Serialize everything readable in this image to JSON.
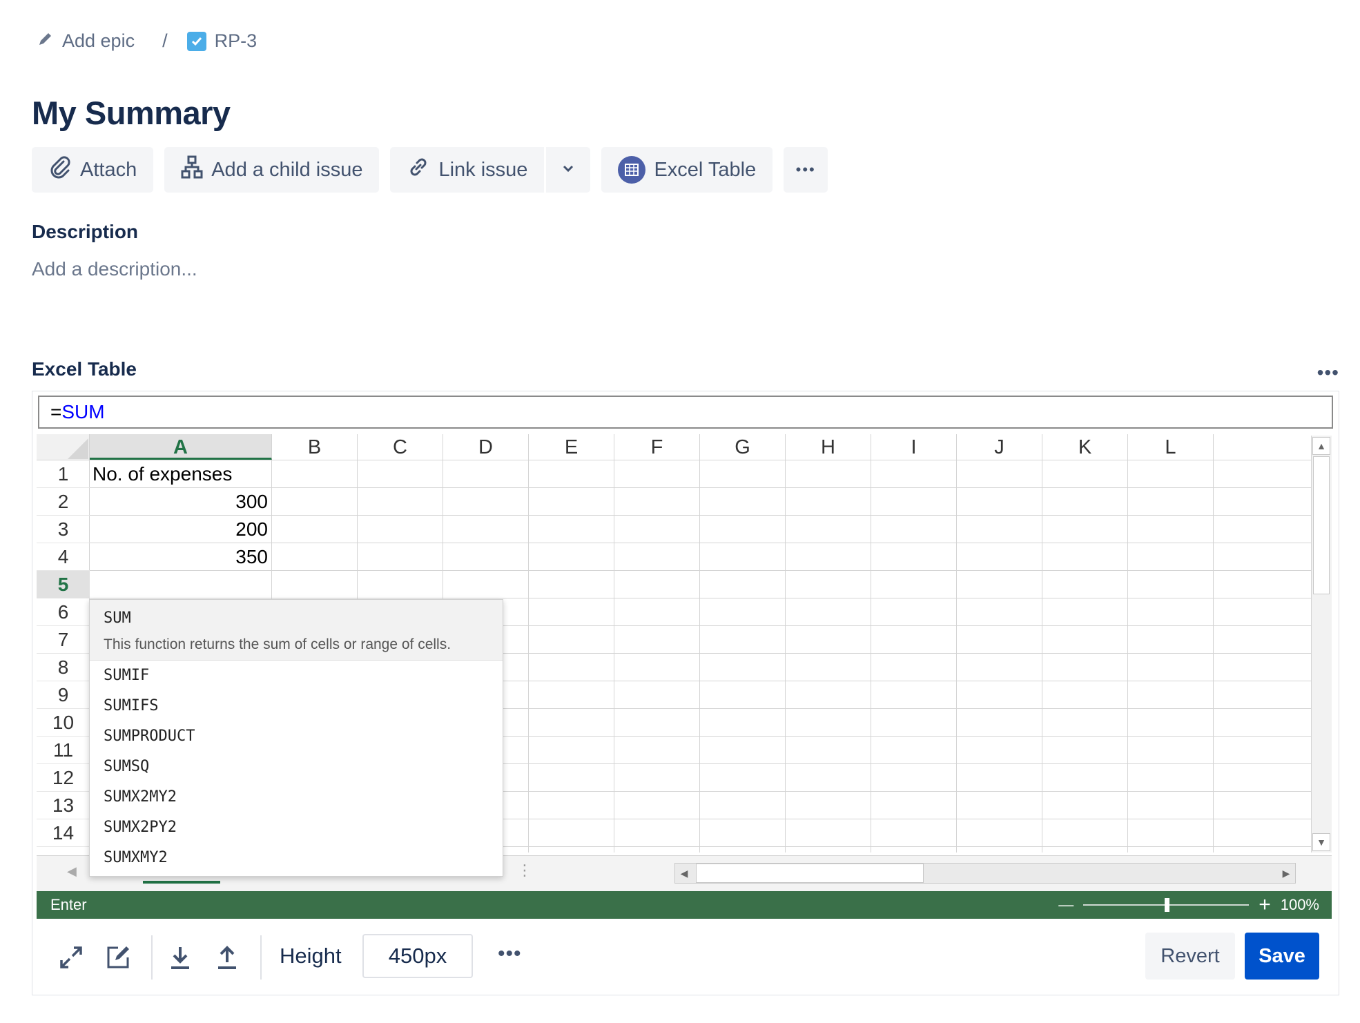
{
  "breadcrumb": {
    "epic_label": "Add epic",
    "separator": "/",
    "issue_key": "RP-3"
  },
  "issue": {
    "title": "My Summary"
  },
  "toolbar": {
    "attach": "Attach",
    "add_child": "Add a child issue",
    "link_issue": "Link issue",
    "excel_table": "Excel Table",
    "more": "•••"
  },
  "description": {
    "heading": "Description",
    "placeholder": "Add a description..."
  },
  "excel_section": {
    "heading": "Excel Table",
    "more": "•••"
  },
  "formula_bar": {
    "eq": "=",
    "fn": "SUM"
  },
  "spreadsheet": {
    "columns": [
      "A",
      "B",
      "C",
      "D",
      "E",
      "F",
      "G",
      "H",
      "I",
      "J",
      "K",
      "L"
    ],
    "rows": [
      "1",
      "2",
      "3",
      "4",
      "5",
      "6",
      "7",
      "8",
      "9",
      "10",
      "11",
      "12",
      "13",
      "14"
    ],
    "selected_column": "A",
    "selected_row": "5",
    "cells": {
      "A1": "No. of expenses",
      "A2": "300",
      "A3": "200",
      "A4": "350"
    },
    "active_cell": {
      "eq": "=",
      "fn": "SUM"
    }
  },
  "autocomplete": {
    "selected": {
      "name": "SUM",
      "description": "This function returns the sum of cells or range of cells."
    },
    "items": [
      "SUMIF",
      "SUMIFS",
      "SUMPRODUCT",
      "SUMSQ",
      "SUMX2MY2",
      "SUMX2PY2",
      "SUMXMY2"
    ]
  },
  "status_bar": {
    "mode": "Enter",
    "zoom": "100%",
    "zoom_minus": "—",
    "zoom_plus": "+"
  },
  "bottom_bar": {
    "height_label": "Height",
    "height_value": "450px",
    "more": "•••",
    "revert": "Revert",
    "save": "Save"
  },
  "colors": {
    "excel_green": "#217346",
    "status_green": "#3a7049",
    "save_blue": "#0052cc",
    "active_cell_border": "#2f6fde",
    "formula_fn": "#0000ff"
  }
}
